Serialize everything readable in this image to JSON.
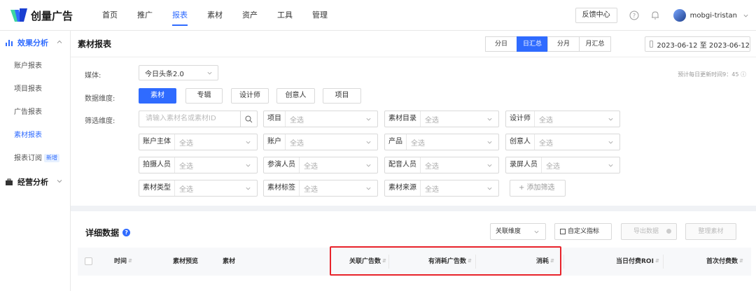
{
  "app": {
    "logo_text": "创量广告"
  },
  "nav": [
    "首页",
    "推广",
    "报表",
    "素材",
    "资产",
    "工具",
    "管理"
  ],
  "nav_active": "报表",
  "header": {
    "feedback": "反馈中心",
    "username": "mobgi-tristan"
  },
  "sidebar": {
    "group1": "效果分析",
    "items": [
      "账户报表",
      "项目报表",
      "广告报表",
      "素材报表",
      "报表订阅"
    ],
    "new_badge": "新增",
    "group2": "经营分析"
  },
  "panel": {
    "title": "素材报表",
    "granularity": [
      "分日",
      "日汇总",
      "分月",
      "月汇总"
    ],
    "granularity_active": "日汇总",
    "date_range": "2023-06-12 至 2023-06-12",
    "media_label": "媒体:",
    "media_value": "今日头条2.0",
    "update_note": "预计每日更新时间9：45 ⓘ",
    "dimension_label": "数据维度:",
    "dimensions": [
      "素材",
      "专辑",
      "设计师",
      "创意人",
      "项目"
    ],
    "dimension_active": "素材",
    "filter_label": "筛选维度:",
    "search_placeholder": "请输入素材名或素材ID",
    "filters": [
      {
        "label": "项目",
        "value": "全选"
      },
      {
        "label": "素材目录",
        "value": "全选"
      },
      {
        "label": "设计师",
        "value": "全选"
      },
      {
        "label": "账户主体",
        "value": "全选"
      },
      {
        "label": "账户",
        "value": "全选"
      },
      {
        "label": "产品",
        "value": "全选"
      },
      {
        "label": "创意人",
        "value": "全选"
      },
      {
        "label": "拍摄人员",
        "value": "全选"
      },
      {
        "label": "参演人员",
        "value": "全选"
      },
      {
        "label": "配音人员",
        "value": "全选"
      },
      {
        "label": "录屏人员",
        "value": "全选"
      },
      {
        "label": "素材类型",
        "value": "全选"
      },
      {
        "label": "素材标签",
        "value": "全选"
      },
      {
        "label": "素材来源",
        "value": "全选"
      }
    ],
    "add_filter": "+ 添加筛选"
  },
  "detail": {
    "title": "详细数据",
    "assoc_dimension": "关联维度",
    "custom_metrics": "自定义指标",
    "export": "导出数据",
    "organize": "整理素材",
    "columns": [
      "时间",
      "素材预览",
      "素材",
      "关联广告数",
      "有消耗广告数",
      "消耗",
      "当日付费ROI",
      "首次付费数"
    ]
  },
  "colors": {
    "accent": "#2f6bff",
    "highlight": "#e8232b"
  }
}
